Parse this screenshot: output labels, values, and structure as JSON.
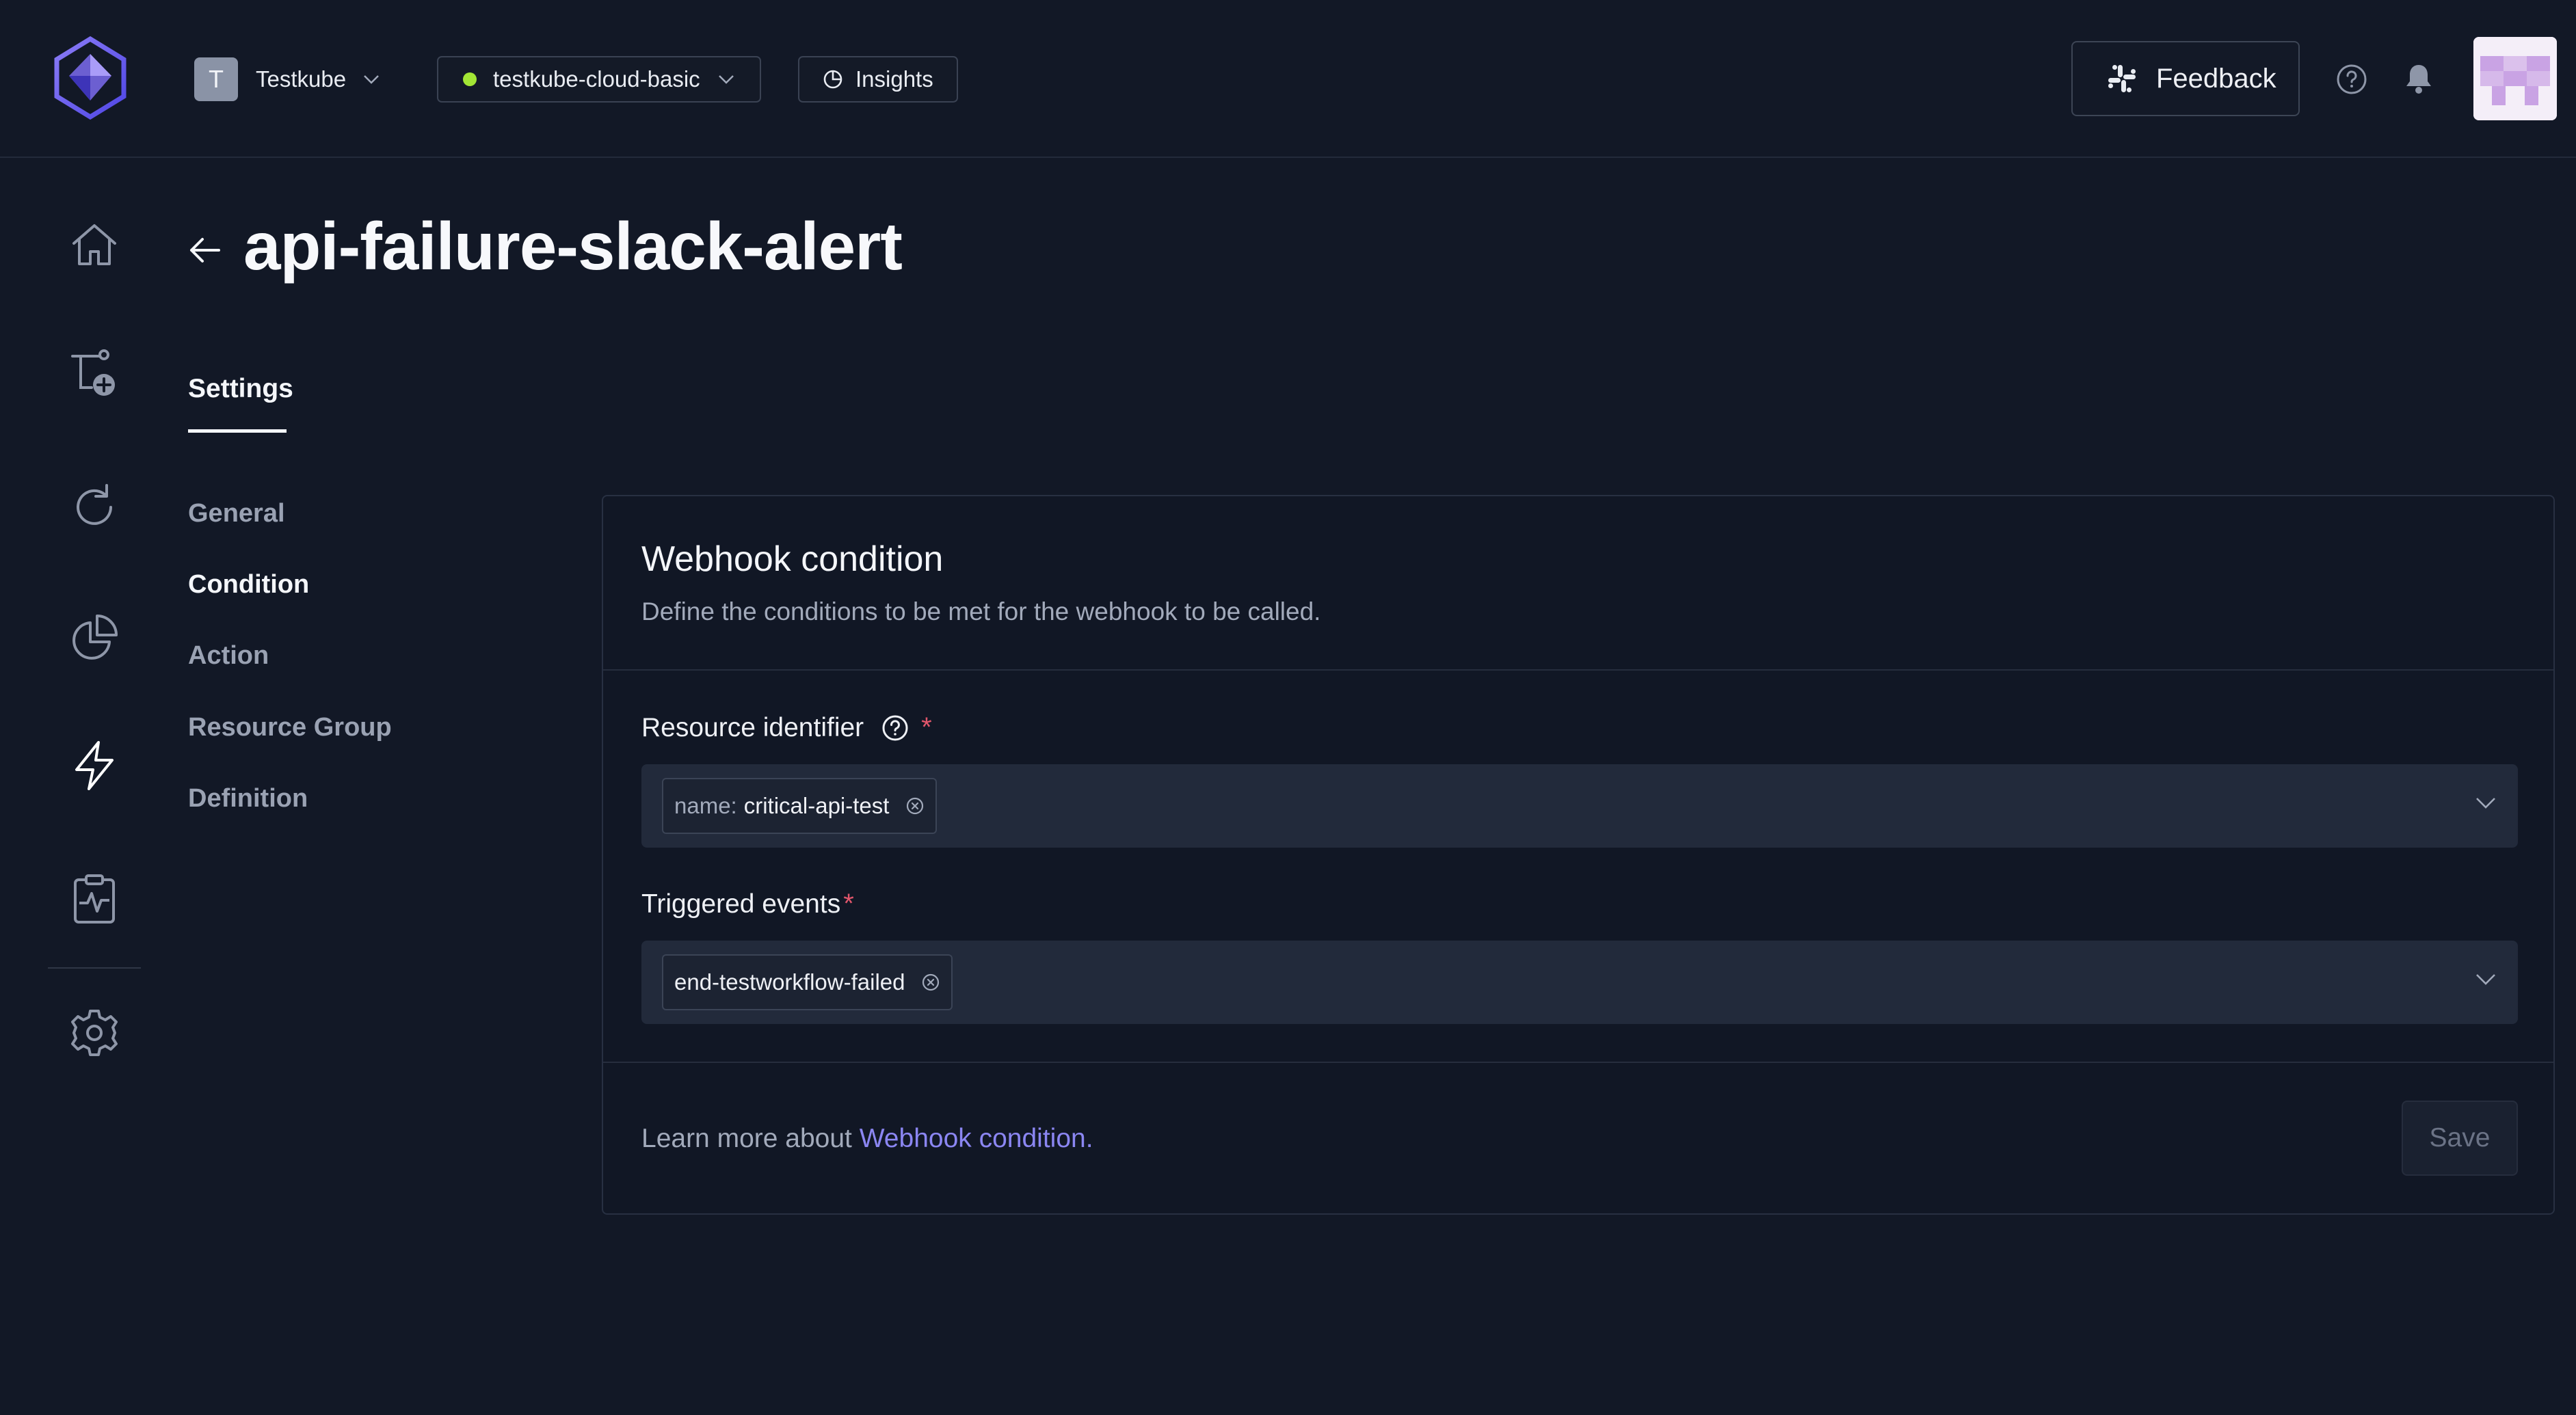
{
  "header": {
    "org": {
      "initial": "T",
      "name": "Testkube"
    },
    "environment": {
      "name": "testkube-cloud-basic",
      "status_color": "#a3e635"
    },
    "insights_label": "Insights",
    "feedback_label": "Feedback"
  },
  "sidebar": {
    "items": [
      {
        "name": "home-icon"
      },
      {
        "name": "workflow-add-icon"
      },
      {
        "name": "refresh-icon"
      },
      {
        "name": "pie-chart-icon"
      },
      {
        "name": "lightning-icon",
        "active": true
      },
      {
        "name": "clipboard-pulse-icon"
      },
      {
        "name": "gear-icon"
      }
    ]
  },
  "page": {
    "title": "api-failure-slack-alert",
    "tabs": [
      {
        "label": "Settings",
        "active": true
      }
    ]
  },
  "subnav": {
    "items": [
      {
        "label": "General",
        "active": false
      },
      {
        "label": "Condition",
        "active": true
      },
      {
        "label": "Action",
        "active": false
      },
      {
        "label": "Resource Group",
        "active": false
      },
      {
        "label": "Definition",
        "active": false
      }
    ]
  },
  "card": {
    "title": "Webhook condition",
    "description": "Define the conditions to be met for the webhook to be called.",
    "resource_identifier": {
      "label": "Resource identifier",
      "required_mark": "*",
      "chips": [
        {
          "key": "name:",
          "value": "critical-api-test"
        }
      ]
    },
    "triggered_events": {
      "label": "Triggered events",
      "required_mark": "*",
      "chips": [
        {
          "value": "end-testworkflow-failed"
        }
      ]
    },
    "footer": {
      "learn_text": "Learn more about ",
      "learn_link": "Webhook condition.",
      "save_label": "Save"
    }
  },
  "colors": {
    "background": "#121826",
    "accent_link": "#8b86f2",
    "required": "#e0566b",
    "active_nav_icon": "#ffffff",
    "inactive_nav_icon": "#8e96a8"
  }
}
